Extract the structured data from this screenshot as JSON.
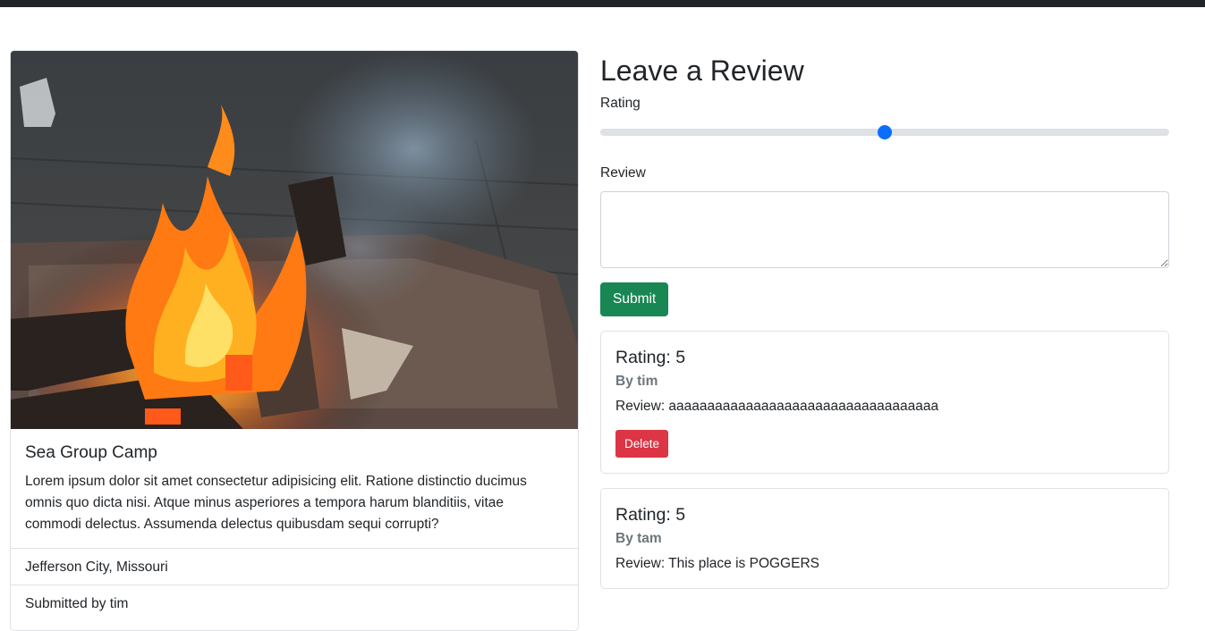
{
  "campground": {
    "title": "Sea Group Camp",
    "description": "Lorem ipsum dolor sit amet consectetur adipisicing elit. Ratione distinctio ducimus omnis quo dicta nisi. Atque minus asperiores a tempora harum blanditiis, vitae commodi delectus. Assumenda delectus quibusdam sequi corrupti?",
    "location": "Jefferson City, Missouri",
    "submitted_by": "Submitted by tim"
  },
  "review_form": {
    "heading": "Leave a Review",
    "rating_label": "Rating",
    "rating_value": 3,
    "rating_min": 1,
    "rating_max": 5,
    "review_label": "Review",
    "review_value": "",
    "submit_label": "Submit"
  },
  "reviews": [
    {
      "rating_text": "Rating: 5",
      "author_text": "By tim",
      "review_text": "Review: aaaaaaaaaaaaaaaaaaaaaaaaaaaaaaaaaaa",
      "delete_label": "Delete"
    },
    {
      "rating_text": "Rating: 5",
      "author_text": "By tam",
      "review_text": "Review: This place is POGGERS"
    }
  ],
  "colors": {
    "topbar": "#212529",
    "range_thumb": "#0d6efd",
    "submit_button": "#198754",
    "delete_button": "#dc3545",
    "muted_text": "#6c757d"
  },
  "icons": {
    "campfire_image": "campfire-photo"
  }
}
